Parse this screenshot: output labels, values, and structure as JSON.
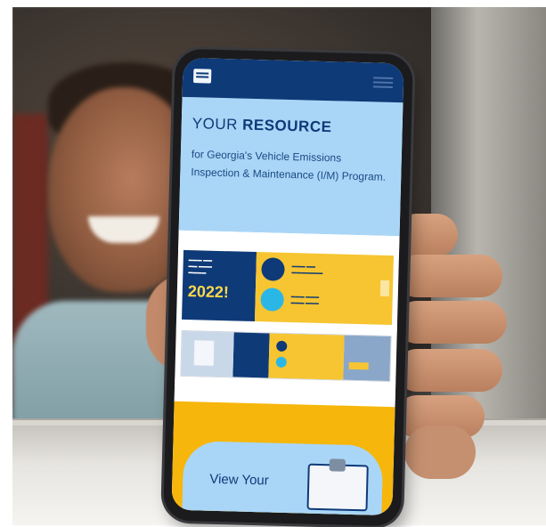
{
  "phone": {
    "hero": {
      "title_regular": "YOUR",
      "title_bold": "RESOURCE",
      "text": "for Georgia's Vehicle Emissions Inspection & Maintenance (I/M) Program."
    },
    "banner": {
      "year": "2022!"
    },
    "bottom": {
      "button_label": "View Your"
    }
  },
  "colors": {
    "navy": "#0e3a78",
    "light_blue": "#a9d6f7",
    "yellow": "#f6c531",
    "gold": "#f6b60b",
    "cyan": "#2bb7e6"
  }
}
